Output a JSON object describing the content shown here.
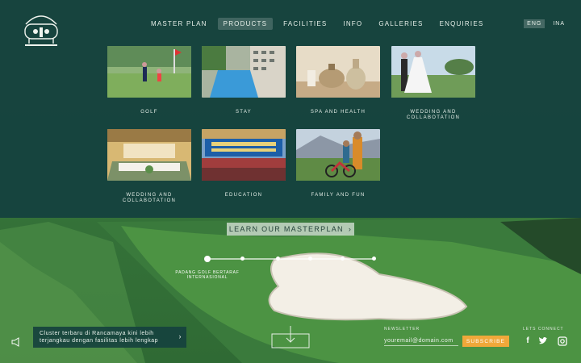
{
  "nav": {
    "items": [
      "MASTER PLAN",
      "PRODUCTS",
      "FACILITIES",
      "INFO",
      "GALLERIES",
      "ENQUIRIES"
    ],
    "active": "PRODUCTS"
  },
  "lang": {
    "eng": "ENG",
    "ina": "INA",
    "active": "ENG"
  },
  "products": [
    {
      "label": "GOLF"
    },
    {
      "label": "STAY"
    },
    {
      "label": "SPA AND HEALTH"
    },
    {
      "label": "WEDDING AND COLLABOTATION"
    },
    {
      "label": "WEDDING AND COLLABOTATION"
    },
    {
      "label": "EDUCATION"
    },
    {
      "label": "FAMILY AND FUN"
    }
  ],
  "hero": {
    "cta_label": "LEARN OUR MASTERPLAN",
    "timeline_label": "PADANG GOLF BERTARAF INTERNASIONAL",
    "timeline_active_index": 0
  },
  "notice": {
    "text": "Cluster terbaru di Rancamaya kini lebih terjangkau dengan fasilitas lebih lengkap"
  },
  "footer": {
    "newsletter_label": "NEWSLETTER",
    "email_placeholder": "youremail@domain.com",
    "subscribe_label": "SUBSCRIBE",
    "connect_label": "LETS CONNECT",
    "social": [
      "facebook-icon",
      "twitter-icon",
      "instagram-icon"
    ]
  },
  "colors": {
    "panel": "#16423e",
    "accent": "#f0a83a"
  }
}
